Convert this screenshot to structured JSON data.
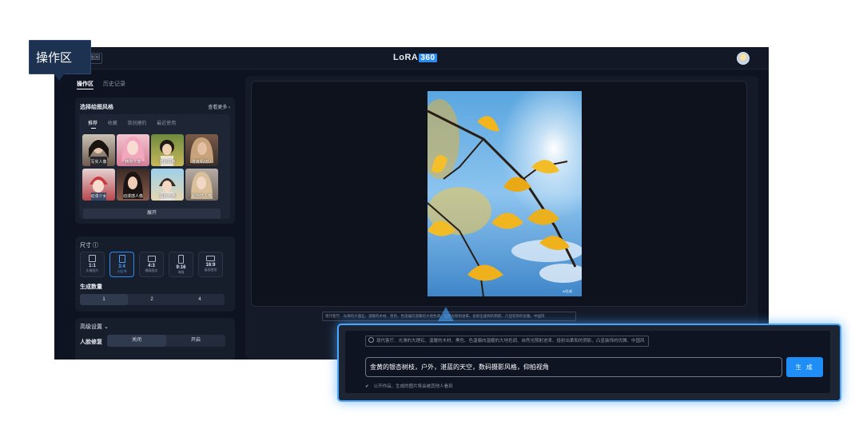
{
  "tooltip": {
    "label": "操作区"
  },
  "topbar": {
    "back_label": "返回",
    "brand_text": "LoRA",
    "brand_badge": "360"
  },
  "sidebar": {
    "tabs": [
      "操作区",
      "历史记录"
    ],
    "style_section": {
      "title": "选择绘图风格",
      "more": "查看更多 ›",
      "subtabs": [
        "推荐",
        "收藏",
        "我创建的",
        "最近使用"
      ],
      "styles": [
        "写实人像",
        "精致人像",
        "日杂风格",
        "发克机动队",
        "动漫少女",
        "动漫感人像",
        "清新卡通",
        "超自然人像"
      ],
      "expand_label": "展开"
    },
    "size_section": {
      "title": "尺寸 ⓘ",
      "ratios": [
        {
          "ratio": "1:1",
          "desc": "头像图片"
        },
        {
          "ratio": "3:4",
          "desc": "小红书"
        },
        {
          "ratio": "4:3",
          "desc": "横版图文"
        },
        {
          "ratio": "9:16",
          "desc": "海报"
        },
        {
          "ratio": "16:9",
          "desc": "桌面壁纸"
        }
      ],
      "count_label": "生成数量",
      "counts": [
        "1",
        "2",
        "4"
      ]
    },
    "advanced": {
      "title": "高级设置 ⌄",
      "face_fix_label": "人脸修复",
      "off": "关闭",
      "on": "开启"
    }
  },
  "canvas": {
    "watermark": "AI生成",
    "prompt_hint": "现代客厅、光滑的大理石、温暖的木材、黑色、色温偏向温暖的大地色调、自然光照射进来、投射出柔和的阴影、凸显装饰的优雅、中国风"
  },
  "zoom_panel": {
    "chip": "现代客厅、光滑的大理石、温暖的木材、黑色、色温偏向温暖的大地色调、自然光照射进来、投射出柔和的阴影、凸显装饰的优雅、中国风",
    "prompt_value": "金黄的银杏树枝，户外，湛蓝的天空，数码摄影风格，仰拍视角",
    "generate_label": "生 成",
    "public_note": "公开作品，生成的图片将会被其他人看到"
  },
  "colors": {
    "accent": "#1f8ef7",
    "bg": "#0d1320",
    "panel": "#161d2b"
  }
}
